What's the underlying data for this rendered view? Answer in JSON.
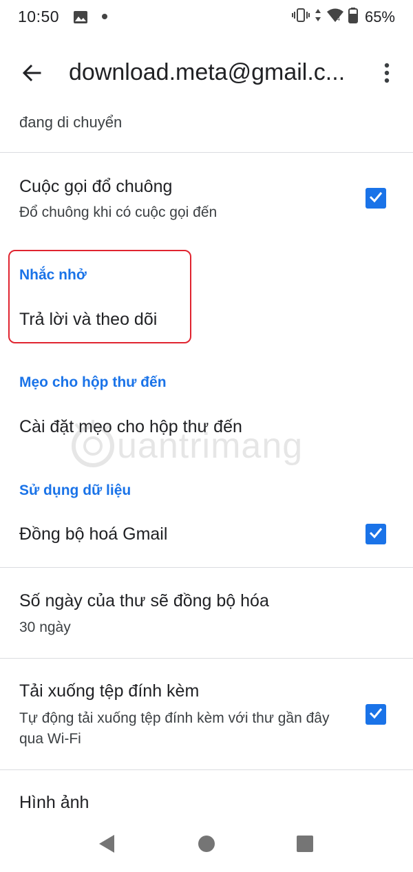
{
  "status_bar": {
    "time": "10:50",
    "battery": "65%",
    "icons": [
      "gallery-icon",
      "dot-icon",
      "vibrate-icon",
      "data-arrows-icon",
      "wifi-icon",
      "battery-icon"
    ]
  },
  "app_bar": {
    "title": "download.meta@gmail.c...",
    "back_icon": "arrow-back-icon",
    "more_icon": "more-vert-icon"
  },
  "settings": {
    "partial_item_text": "đang di chuyển",
    "call_ringing": {
      "title": "Cuộc gọi đổ chuông",
      "subtitle": "Đổ chuông khi có cuộc gọi đến",
      "checked": true
    },
    "nudges": {
      "header": "Nhắc nhở",
      "item": "Trả lời và theo dõi"
    },
    "inbox_tips": {
      "header": "Mẹo cho hộp thư đến",
      "item": "Cài đặt mẹo cho hộp thư đến"
    },
    "data_usage": {
      "header": "Sử dụng dữ liệu",
      "sync_gmail": {
        "title": "Đồng bộ hoá Gmail",
        "checked": true
      },
      "days_to_sync": {
        "title": "Số ngày của thư sẽ đồng bộ hóa",
        "value": "30 ngày"
      },
      "download_attachments": {
        "title": "Tải xuống tệp đính kèm",
        "subtitle": "Tự động tải xuống tệp đính kèm với thư gần đây qua Wi-Fi",
        "checked": true
      },
      "images": {
        "title": "Hình ảnh"
      }
    }
  },
  "watermark": {
    "text": "uantrimang"
  },
  "colors": {
    "accent": "#1a73e8",
    "highlight": "#e0242f",
    "divider": "#dadce0"
  }
}
